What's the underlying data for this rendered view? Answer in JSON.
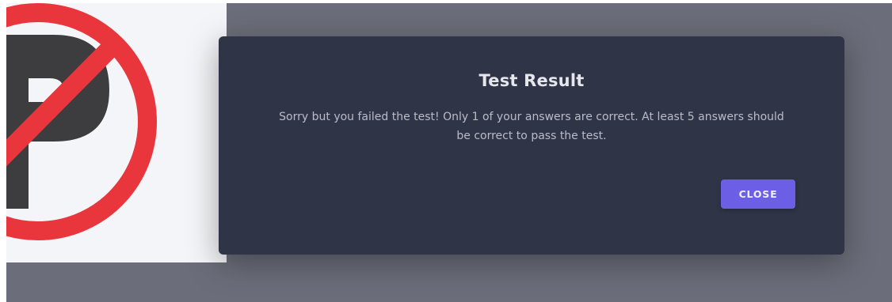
{
  "background": {
    "image_icon": "no-parking-icon",
    "colors": {
      "sign_red": "#e8363c",
      "sign_letter": "#3d3d3f",
      "image_bg": "#f4f5f8",
      "backdrop": "#6b6e7a"
    }
  },
  "dialog": {
    "title": "Test Result",
    "message": "Sorry but you failed the test! Only 1 of your answers are correct. At least 5 answers should be correct to pass the test.",
    "close_label": "CLOSE",
    "colors": {
      "surface": "#303447",
      "accent": "#6c5fe6"
    }
  }
}
